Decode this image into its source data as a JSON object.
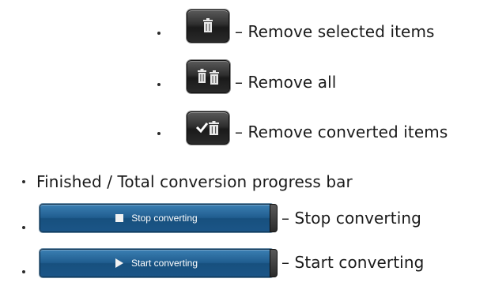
{
  "items": {
    "remove_selected": {
      "icon": "trash-icon",
      "label": "– Remove selected items"
    },
    "remove_all": {
      "icon": "double-trash-icon",
      "label": "– Remove all"
    },
    "remove_converted": {
      "icon": "check-trash-icon",
      "label": "– Remove converted items"
    },
    "progress_bar": {
      "label": "Finished / Total conversion progress bar"
    },
    "stop": {
      "button_label": "Stop converting",
      "icon": "stop-icon",
      "label": "– Stop converting"
    },
    "start": {
      "button_label": "Start converting",
      "icon": "play-icon",
      "label": "– Start converting"
    }
  },
  "colors": {
    "text": "#1a1a1a",
    "icon_button": "#2e2e2e",
    "blue_button": "#205d8f"
  }
}
